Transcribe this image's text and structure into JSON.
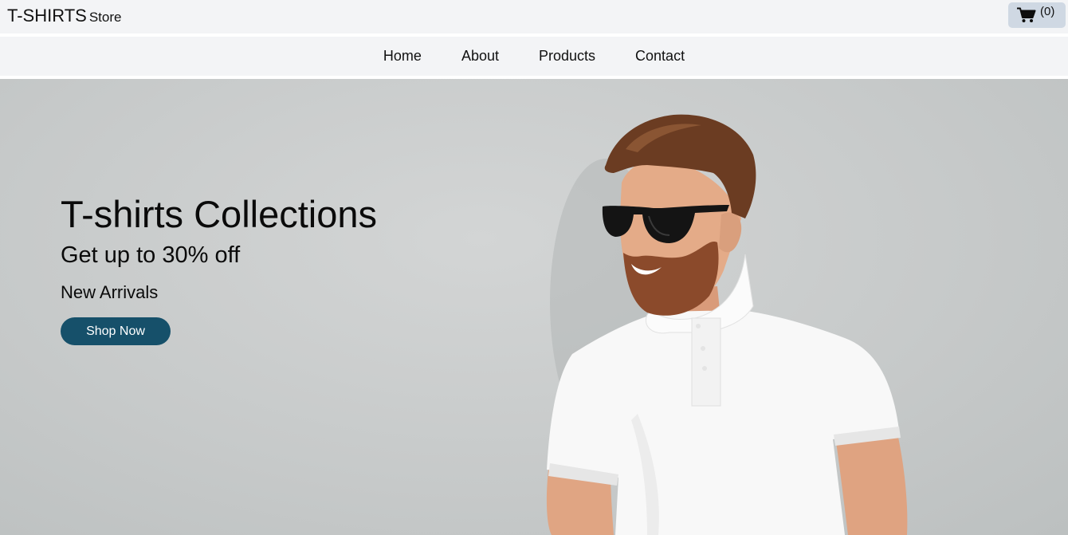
{
  "header": {
    "brand_main": "T-SHIRTS",
    "brand_sub": "Store",
    "cart_count": "(0)",
    "cart_icon": "shopping-cart-icon"
  },
  "nav": {
    "items": [
      {
        "label": "Home"
      },
      {
        "label": "About"
      },
      {
        "label": "Products"
      },
      {
        "label": "Contact"
      }
    ]
  },
  "hero": {
    "title": "T-shirts Collections",
    "subtitle": "Get up to 30% off",
    "tagline": "New Arrivals",
    "cta_label": "Shop Now",
    "image": "man-in-white-polo-shirt-and-sunglasses"
  },
  "colors": {
    "cta": "#16506a",
    "bar_background": "#f3f4f6",
    "cart_button": "#cfd8e3",
    "hero_background": "#c8cbcb"
  }
}
